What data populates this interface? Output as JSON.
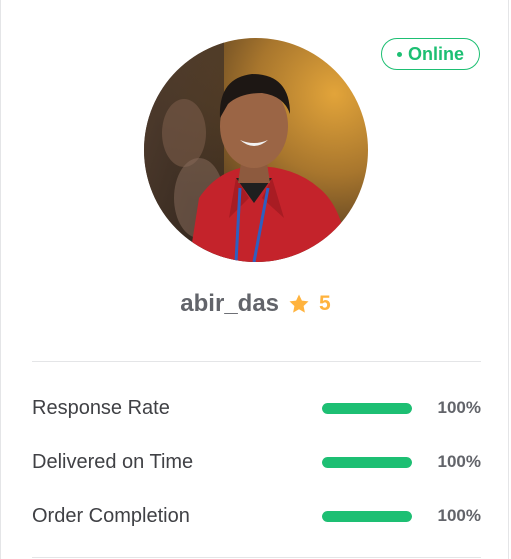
{
  "status": {
    "label": "Online",
    "color": "#1dbf73"
  },
  "profile": {
    "avatar_icon": "profile-photo",
    "username": "abir_das",
    "star_icon": "star-icon",
    "rating": "5",
    "rating_color": "#ffb33e"
  },
  "stats": [
    {
      "label": "Response Rate",
      "value": "100%",
      "level": 1.0
    },
    {
      "label": "Delivered on Time",
      "value": "100%",
      "level": 1.0
    },
    {
      "label": "Order Completion",
      "value": "100%",
      "level": 1.0
    }
  ],
  "colors": {
    "accent": "#1dbf73",
    "bar_track": "#e4e5e7",
    "text": "#404145",
    "muted": "#62646a"
  }
}
